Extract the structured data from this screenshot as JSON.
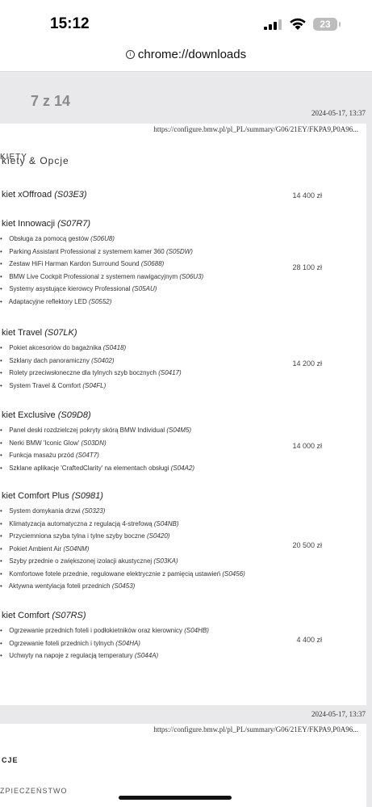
{
  "status_bar": {
    "time": "15:12",
    "battery": "23"
  },
  "url_bar": {
    "url": "chrome://downloads"
  },
  "viewer": {
    "page_counter": "7 z 14",
    "timestamp": "2024-05-17, 13:37",
    "page_url": "https://configure.bmw.pl/pl_PL/summary/G06/21EY/FKPA9,P0A96...",
    "page1": {
      "header_left": "KIETY",
      "header_right": "kiety & Opcje",
      "packages": [
        {
          "name": "kiet xOffroad",
          "code": "(S03E3)",
          "price": "14 400 zł",
          "items": []
        },
        {
          "name": "kiet Innowacji",
          "code": "(S07R7)",
          "price": "28 100 zł",
          "items": [
            {
              "text": "Obsługa za pomocą gestów",
              "code": "(S06U8)"
            },
            {
              "text": "Parking Assistant Professional z systemem kamer 360",
              "code": "(S05DW)"
            },
            {
              "text": "Zestaw HiFi Harman Kardon Surround Sound",
              "code": "(S0688)"
            },
            {
              "text": "BMW Live Cockpit Professional z systemem nawigacyjnym",
              "code": "(S06U3)"
            },
            {
              "text": "Systemy asystujące kierowcy Professional",
              "code": "(S05AU)"
            },
            {
              "text": "Adaptacyjne reflektory LED",
              "code": "(S0552)"
            }
          ]
        },
        {
          "name": "kiet Travel",
          "code": "(S07LK)",
          "price": "14 200 zł",
          "items": [
            {
              "text": "Pokiet akcesoriów do bagażnika",
              "code": "(S0418)"
            },
            {
              "text": "Szklany dach panoramiczny",
              "code": "(S0402)"
            },
            {
              "text": "Rolety przeciwsłoneczne dla tylnych szyb bocznych",
              "code": "(S0417)"
            },
            {
              "text": "System Travel & Comfort",
              "code": "(S04FL)"
            }
          ]
        },
        {
          "name": "kiet Exclusive",
          "code": "(S09D8)",
          "price": "14 000 zł",
          "items": [
            {
              "text": "Panel deski rozdzielczej pokryty skórą BMW Individual",
              "code": "(S04M5)"
            },
            {
              "text": "Nerki BMW 'Iconic Glow'",
              "code": "(S03DN)"
            },
            {
              "text": "Funkcja masażu przód",
              "code": "(S04T7)"
            },
            {
              "text": "Szklane aplikacje 'CraftedClarity' na elementach obsługi",
              "code": "(S04A2)"
            }
          ]
        },
        {
          "name": "kiet Comfort Plus",
          "code": "(S0981)",
          "price": "20 500 zł",
          "items": [
            {
              "text": "System domykania drzwi",
              "code": "(S0323)"
            },
            {
              "text": "Klimatyzacja automatyczna z regulacją 4-strefową",
              "code": "(S04NB)"
            },
            {
              "text": "Przyciemniona szyba tylna i tylne szyby boczne",
              "code": "(S0420)"
            },
            {
              "text": "Pokiet Ambient Air",
              "code": "(S04NM)"
            },
            {
              "text": "Szyby przednie o zwiększonej izolacji akustycznej",
              "code": "(S03KA)"
            },
            {
              "text": "Komfortowe fotele przednie, regulowane elektrycznie z pamięcią ustawień",
              "code": "(S0456)"
            },
            {
              "text": "Aktywna wentylacja foteli przednich",
              "code": "(S0453)"
            }
          ]
        },
        {
          "name": "kiet Comfort",
          "code": "(S07RS)",
          "price": "4 400 zł",
          "items": [
            {
              "text": "Ogrzewanie przednich foteli i podłokietników oraz kierownicy",
              "code": "(S04HB)"
            },
            {
              "text": "Ogrzewanie foteli przednich i tylnych",
              "code": "(S04HA)"
            },
            {
              "text": "Uchwyty na napoje z regulacją temperatury",
              "code": "(S044A)"
            }
          ]
        }
      ]
    },
    "page2": {
      "title": "CJE",
      "subtitle": "ZPIECZEŃSTWO"
    }
  },
  "icons": {
    "info": "info-icon",
    "signal": "cellular-signal-icon",
    "wifi": "wifi-icon",
    "battery": "battery-icon"
  }
}
